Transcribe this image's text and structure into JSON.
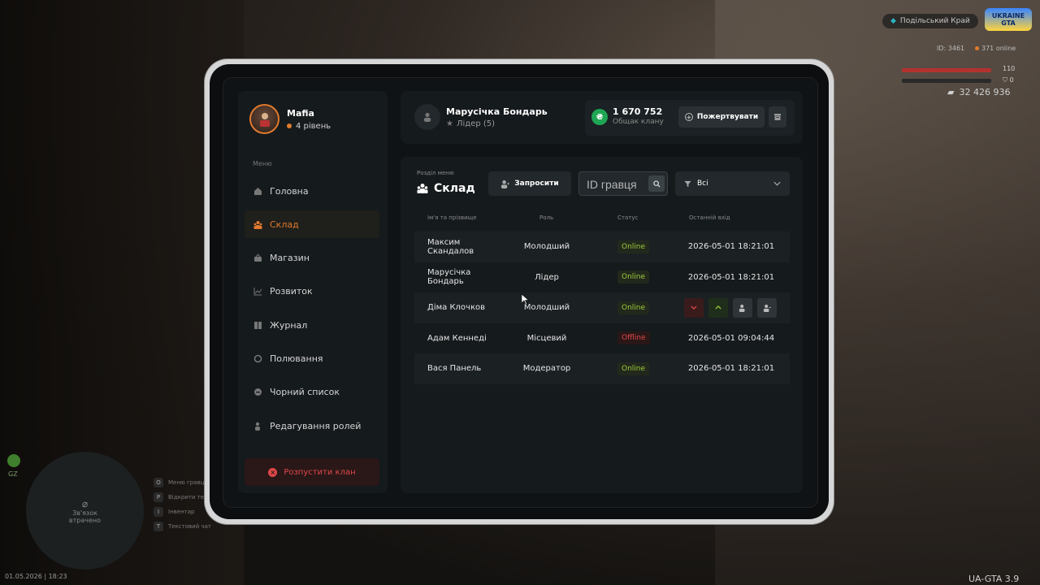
{
  "hud": {
    "server": "Подільський Край",
    "logo_line1": "UKRAINE",
    "logo_line2": "GTA",
    "player_id": "ID: 3461",
    "online": "371 online",
    "health": "110",
    "armor": "0",
    "money": "32 426 936"
  },
  "minimap": {
    "line1": "Зв'язок",
    "line2": "втрачено"
  },
  "gz_label": "GZ",
  "hints": [
    {
      "key": "O",
      "text": "Меню гравця"
    },
    {
      "key": "P",
      "text": "Відкрити телефон"
    },
    {
      "key": "I",
      "text": "Інвентар"
    },
    {
      "key": "T",
      "text": "Текстовий чат"
    }
  ],
  "datetime": "01.05.2026 | 18:23",
  "version": "UA-GTA 3.9",
  "profile": {
    "name": "Mafia",
    "level": "4 рівень"
  },
  "menu_caption": "Меню",
  "menu": [
    {
      "label": "Головна",
      "icon": "home-icon"
    },
    {
      "label": "Склад",
      "icon": "people-icon",
      "active": true
    },
    {
      "label": "Магазин",
      "icon": "basket-icon"
    },
    {
      "label": "Розвиток",
      "icon": "chart-icon"
    },
    {
      "label": "Журнал",
      "icon": "book-icon"
    },
    {
      "label": "Полювання",
      "icon": "circle-icon"
    },
    {
      "label": "Чорний список",
      "icon": "minus-circle-icon"
    },
    {
      "label": "Редагування ролей",
      "icon": "user-edit-icon"
    }
  ],
  "disband_label": "Розпустити клан",
  "header": {
    "user_name": "Марусічка Бондарь",
    "user_role": "Лідер (5)",
    "treasury_amount": "1 670 752",
    "treasury_label": "Общак клану",
    "donate_label": "Пожертвувати"
  },
  "section": {
    "caption": "Розділ меню",
    "title": "Склад",
    "invite_label": "Запросити",
    "search_placeholder": "ID гравця",
    "filter_label": "Всі"
  },
  "table": {
    "columns": [
      "Ім'я та прізвище",
      "Роль",
      "Статус",
      "Останній вхід"
    ],
    "rows": [
      {
        "name": "Максим Скандалов",
        "role": "Молодший",
        "status": "Online",
        "last": "2026-05-01 18:21:01"
      },
      {
        "name": "Марусічка Бондарь",
        "role": "Лідер",
        "status": "Online",
        "last": "2026-05-01 18:21:01"
      },
      {
        "name": "Діма Клочков",
        "role": "Молодший",
        "status": "Online",
        "last": ""
      },
      {
        "name": "Адам Кеннеді",
        "role": "Місцевий",
        "status": "Offline",
        "last": "2026-05-01 09:04:44"
      },
      {
        "name": "Вася Панель",
        "role": "Модератор",
        "status": "Online",
        "last": "2026-05-01 18:21:01"
      }
    ]
  },
  "colors": {
    "accent": "#e07a2f",
    "online": "#9ccc3c",
    "offline": "#e0484a",
    "coin": "#1fa654"
  }
}
